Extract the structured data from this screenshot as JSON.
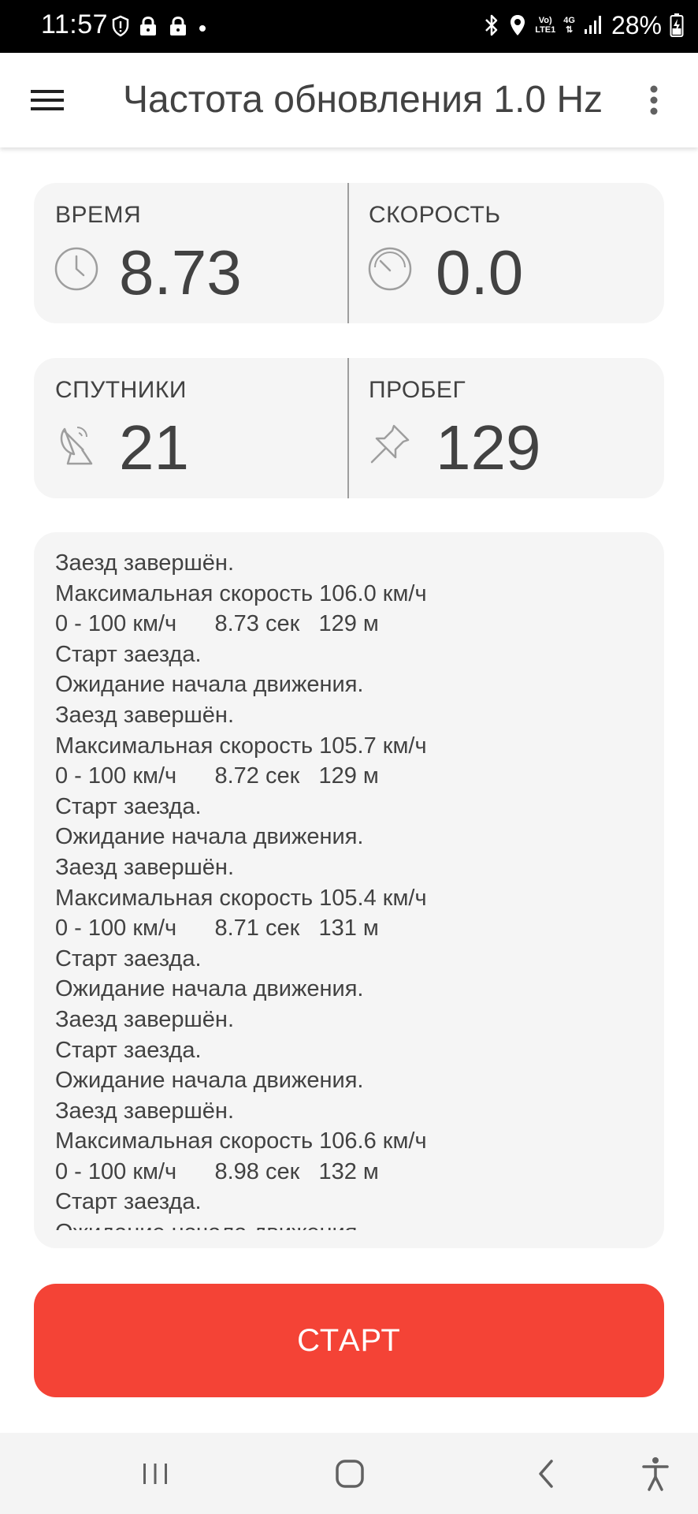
{
  "status_bar": {
    "time": "11:57",
    "network_label_top": "Vo)",
    "network_label_bottom": "LTE1",
    "network_type": "4G",
    "battery": "28%"
  },
  "app_bar": {
    "title": "Частота обновления 1.0 Hz"
  },
  "metrics": {
    "time": {
      "label": "ВРЕМЯ",
      "value": "8.73",
      "icon": "clock-icon"
    },
    "speed": {
      "label": "СКОРОСТЬ",
      "value": "0.0",
      "icon": "speedometer-icon"
    },
    "satellites": {
      "label": "СПУТНИКИ",
      "value": "21",
      "icon": "satellite-dish-icon"
    },
    "distance": {
      "label": "ПРОБЕГ",
      "value": "129",
      "icon": "pushpin-icon"
    }
  },
  "log": [
    "Заезд завершён.",
    "Максимальная скорость 106.0 км/ч",
    "0 - 100 км/ч      8.73 сек   129 м",
    "Старт заезда.",
    "Ожидание начала движения.",
    "Заезд завершён.",
    "Максимальная скорость 105.7 км/ч",
    "0 - 100 км/ч      8.72 сек   129 м",
    "Старт заезда.",
    "Ожидание начала движения.",
    "Заезд завершён.",
    "Максимальная скорость 105.4 км/ч",
    "0 - 100 км/ч      8.71 сек   131 м",
    "Старт заезда.",
    "Ожидание начала движения.",
    "Заезд завершён.",
    "Старт заезда.",
    "Ожидание начала движения.",
    "Заезд завершён.",
    "Максимальная скорость 106.6 км/ч",
    "0 - 100 км/ч      8.98 сек   132 м",
    "Старт заезда.",
    "Ожидание начала движения."
  ],
  "start_button": {
    "label": "СТАРТ"
  },
  "colors": {
    "accent": "#f44336",
    "card_bg": "#f5f5f5",
    "text": "#424242"
  }
}
